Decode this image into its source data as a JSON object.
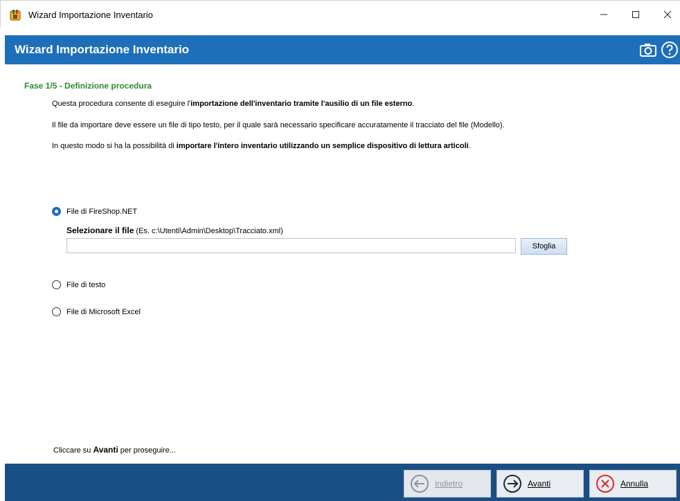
{
  "window": {
    "title": "Wizard Importazione Inventario",
    "controls": [
      "minimize-icon",
      "maximize-icon",
      "close-icon"
    ]
  },
  "header": {
    "title": "Wizard Importazione Inventario",
    "icons": [
      "camera-icon",
      "help-icon"
    ],
    "background": "#1e6fb9"
  },
  "content": {
    "phase": "Fase 1/5 - Definizione procedura",
    "intro": {
      "line1": {
        "pre": "Questa procedura consente di eseguire l'",
        "bold": "importazione dell'inventario tramite l'ausilio di un file esterno",
        "post": "."
      },
      "line2": "Il file da importare deve essere un file di tipo testo, per il quale sarà necessario specificare accuratamente il tracciato del file (Modello).",
      "line3": {
        "pre": "In questo modo si ha la possibilità di ",
        "bold": "importare l'intero inventario utilizzando un semplice dispositivo di lettura articoli",
        "post": "."
      }
    },
    "options": [
      {
        "label": "File di FireShop.NET",
        "checked": true
      },
      {
        "label": "File di testo",
        "checked": false
      },
      {
        "label": "File di Microsoft Excel",
        "checked": false
      }
    ],
    "file_select": {
      "label_bold": "Selezionare il file",
      "label_hint": " (Es. c:\\Utenti\\Admin\\Desktop\\Tracciato.xml)",
      "value": "",
      "browse_label": "Sfoglia"
    },
    "footer_note": {
      "pre": "Cliccare su ",
      "bold": "Avanti",
      "post": " per proseguire..."
    }
  },
  "buttons": {
    "back": {
      "label": "Indietro",
      "enabled": false
    },
    "next": {
      "label": "Avanti",
      "enabled": true
    },
    "cancel": {
      "label": "Annulla",
      "enabled": true
    }
  },
  "colors": {
    "accent": "#1e6fb9",
    "bottom_bar": "#1a4f86",
    "phase_text": "#2f8a2f",
    "cancel_red": "#d62c2c"
  }
}
